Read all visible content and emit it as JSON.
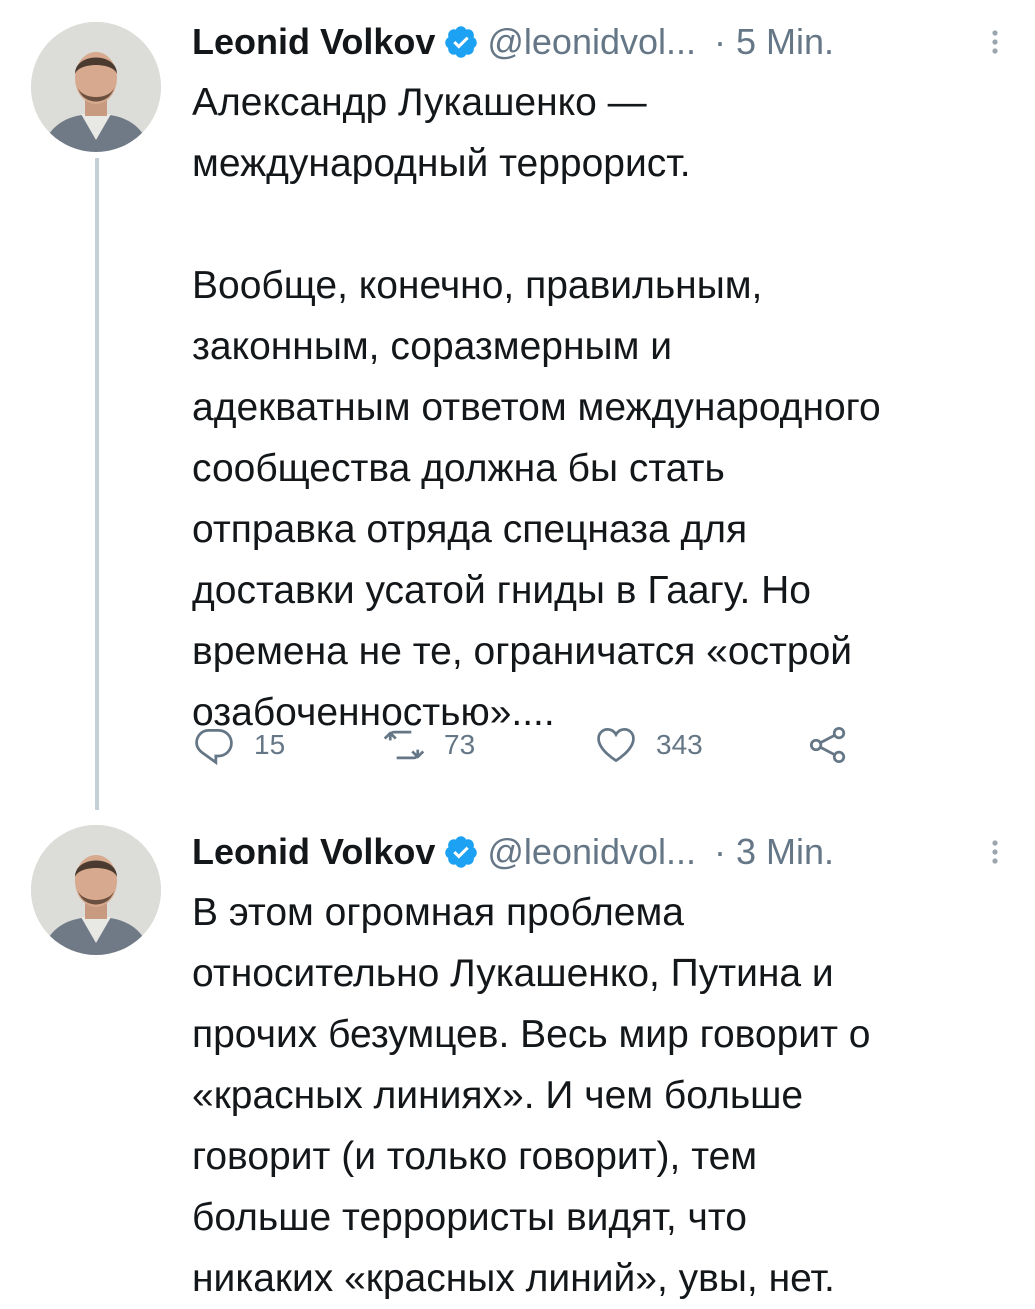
{
  "tweets": [
    {
      "author_name": "Leonid Volkov",
      "handle": "@leonidvol...",
      "time": "5 Min.",
      "separator": "·",
      "text": "Александр Лукашенко —\nмеждународный террорист.\n\nВообще, конечно, правильным,\nзаконным, соразмерным и\nадекватным ответом международного\nсообщества должна бы стать\nотправка отряда спецназа для\nдоставки усатой гниды в Гаагу. Но\nвремена не те, ограничатся «острой\nозабоченностью»....",
      "reply_count": "15",
      "retweet_count": "73",
      "like_count": "343"
    },
    {
      "author_name": "Leonid Volkov",
      "handle": "@leonidvol...",
      "time": "3 Min.",
      "separator": "·",
      "text": "В этом огромная проблема\nотносительно Лукашенко, Путина и\nпрочих безумцев. Весь мир говорит о\n«красных линиях». И чем больше\nговорит (и только говорит), тем\nбольше террористы видят, что\nникаких «красных линий», увы, нет."
    }
  ],
  "colors": {
    "text": "#14171a",
    "secondary": "#657786",
    "verified": "#1da1f2",
    "thread_line": "#c4cfd6"
  },
  "icons": {
    "verified": "verified-badge-icon",
    "more": "more-options-icon",
    "reply": "reply-icon",
    "retweet": "retweet-icon",
    "like": "heart-icon",
    "share": "share-icon"
  }
}
